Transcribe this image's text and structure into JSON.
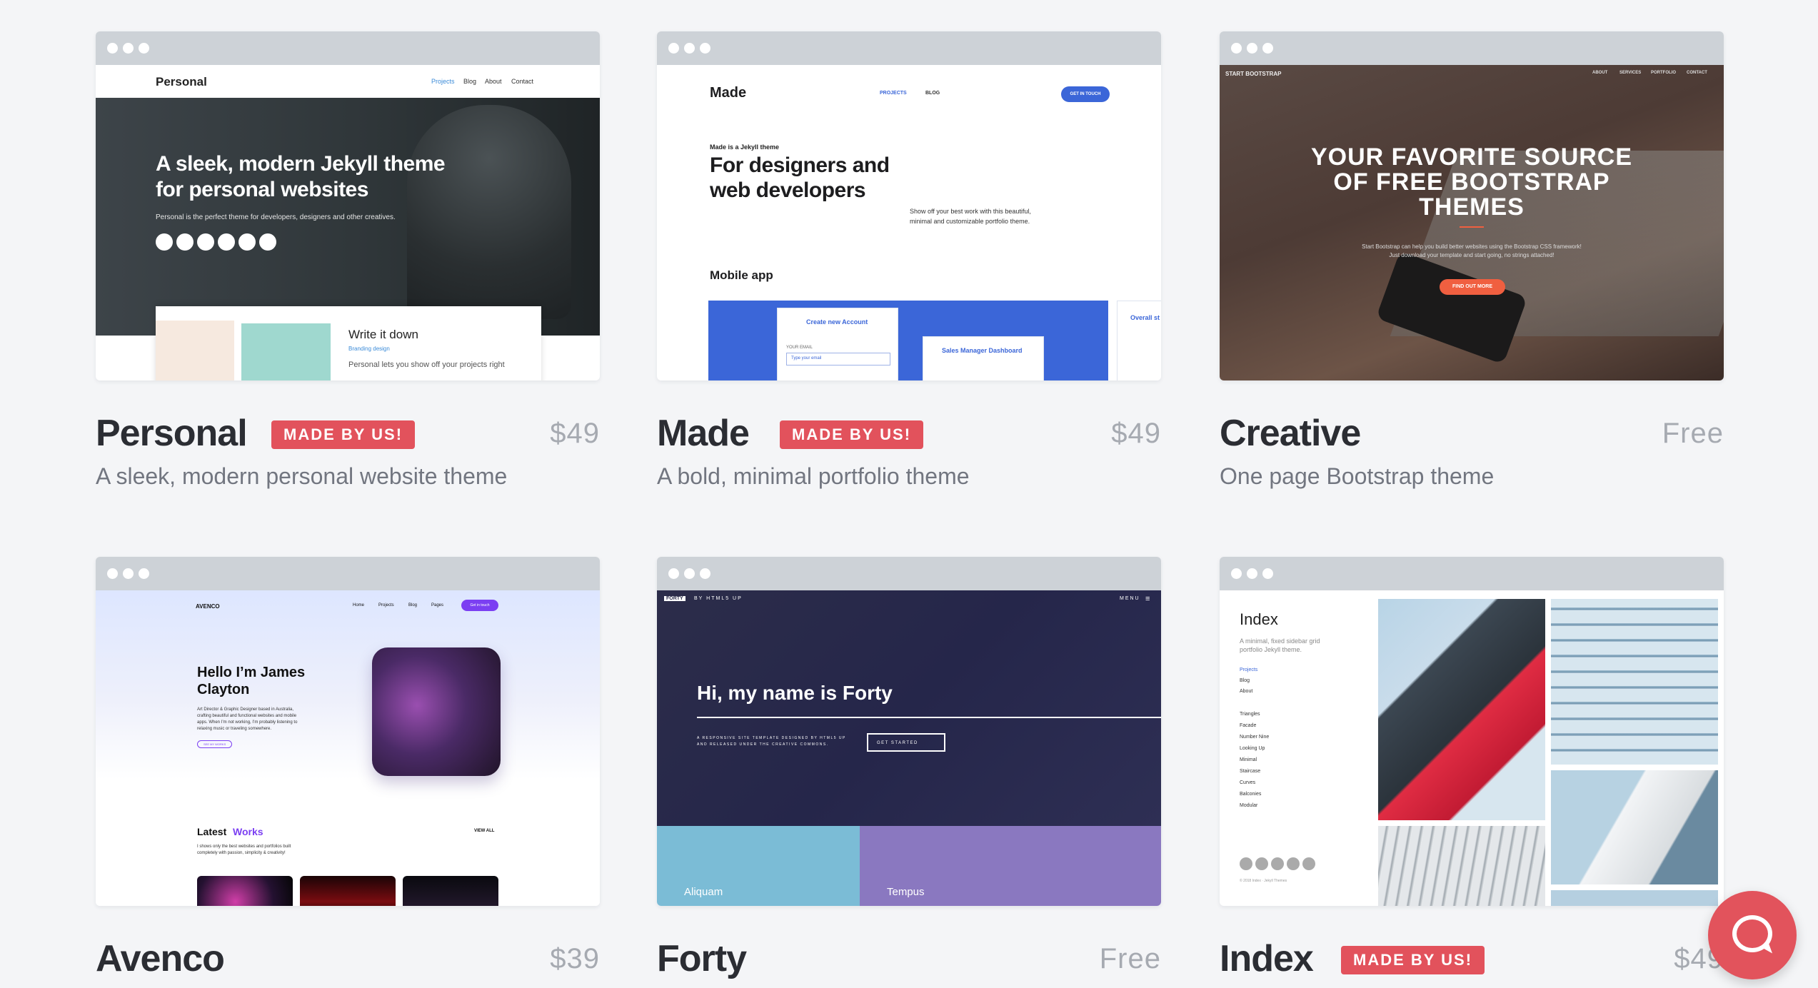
{
  "themes": [
    {
      "name": "Personal",
      "badge": "MADE BY US!",
      "price": "$49",
      "description": "A sleek, modern personal website theme",
      "preview": {
        "brand": "Personal",
        "nav": [
          "Projects",
          "Blog",
          "About",
          "Contact"
        ],
        "headline_1": "A sleek, modern Jekyll theme",
        "headline_2": "for personal websites",
        "subtext": "Personal is the perfect theme for developers, designers and other creatives.",
        "card_title": "Write it down",
        "card_tag": "Branding design",
        "card_text": "Personal lets you show off your projects right"
      }
    },
    {
      "name": "Made",
      "badge": "MADE BY US!",
      "price": "$49",
      "description": "A bold, minimal portfolio theme",
      "preview": {
        "brand": "Made",
        "nav": [
          "PROJECTS",
          "BLOG"
        ],
        "cta": "GET IN TOUCH",
        "eyebrow": "Made is a Jekyll theme",
        "headline_1": "For designers and",
        "headline_2": "web developers",
        "side_text_1": "Show off your best work with this beautiful,",
        "side_text_2": "minimal and customizable portfolio theme.",
        "section": "Mobile app",
        "form_title": "Create new Account",
        "form_label": "YOUR EMAIL",
        "form_placeholder": "Type your email",
        "dash_title": "Sales Manager Dashboard",
        "extra_title": "Overall st"
      }
    },
    {
      "name": "Creative",
      "badge": "",
      "price": "Free",
      "description": "One page Bootstrap theme",
      "preview": {
        "brand": "START BOOTSTRAP",
        "nav": [
          "ABOUT",
          "SERVICES",
          "PORTFOLIO",
          "CONTACT"
        ],
        "headline_1": "YOUR FAVORITE SOURCE",
        "headline_2": "OF FREE BOOTSTRAP",
        "headline_3": "THEMES",
        "subtext_1": "Start Bootstrap can help you build better websites using the Bootstrap CSS framework!",
        "subtext_2": "Just download your template and start going, no strings attached!",
        "cta": "FIND OUT MORE"
      }
    },
    {
      "name": "Avenco",
      "badge": "",
      "price": "$39",
      "description": "",
      "preview": {
        "brand": "AVENCO",
        "nav": [
          "Home",
          "Projects",
          "Blog",
          "Pages"
        ],
        "cta": "Get in touch",
        "headline_1": "Hello I’m James",
        "headline_2": "Clayton",
        "body_1": "Art Director & Graphic Designer based in Australia,",
        "body_2": "crafting beautiful and functional websites and mobile",
        "body_3": "apps. When I’m not working, I’m probably listening to",
        "body_4": "relaxing music or traveling somewhere.",
        "link": "SEE MY WORKS",
        "section_a": "Latest",
        "section_b": "Works",
        "view_all": "VIEW ALL",
        "section_text_1": "I shows only the best websites and portfolios built",
        "section_text_2": "completely with passion, simplicity & creativity!"
      }
    },
    {
      "name": "Forty",
      "badge": "",
      "price": "Free",
      "description": "",
      "preview": {
        "brand_box": "FORTY",
        "brand_rest": "BY HTML5 UP",
        "menu": "MENU",
        "headline": "Hi, my name is Forty",
        "sub_1": "A RESPONSIVE SITE TEMPLATE DESIGNED BY HTML5 UP",
        "sub_2": "AND RELEASED UNDER THE CREATIVE COMMONS.",
        "cta": "GET STARTED",
        "tile_1": "Aliquam",
        "tile_2": "Tempus"
      }
    },
    {
      "name": "Index",
      "badge": "MADE BY US!",
      "price": "$49",
      "description": "",
      "preview": {
        "brand": "Index",
        "tagline_1": "A minimal, fixed sidebar grid",
        "tagline_2": "portfolio Jekyll theme.",
        "nav": [
          "Projects",
          "Blog",
          "About"
        ],
        "list": [
          "Triangles",
          "Facade",
          "Number Nine",
          "Looking Up",
          "Minimal",
          "Staircase",
          "Curves",
          "Balconies",
          "Modular"
        ],
        "footer": "© 2018 Index · Jekyll Themes"
      }
    }
  ],
  "colors": {
    "badge": "#e2525c",
    "page_bg": "#f4f5f7",
    "chrome": "#cdd2d7"
  },
  "help_icon": "chat-bubble-icon"
}
